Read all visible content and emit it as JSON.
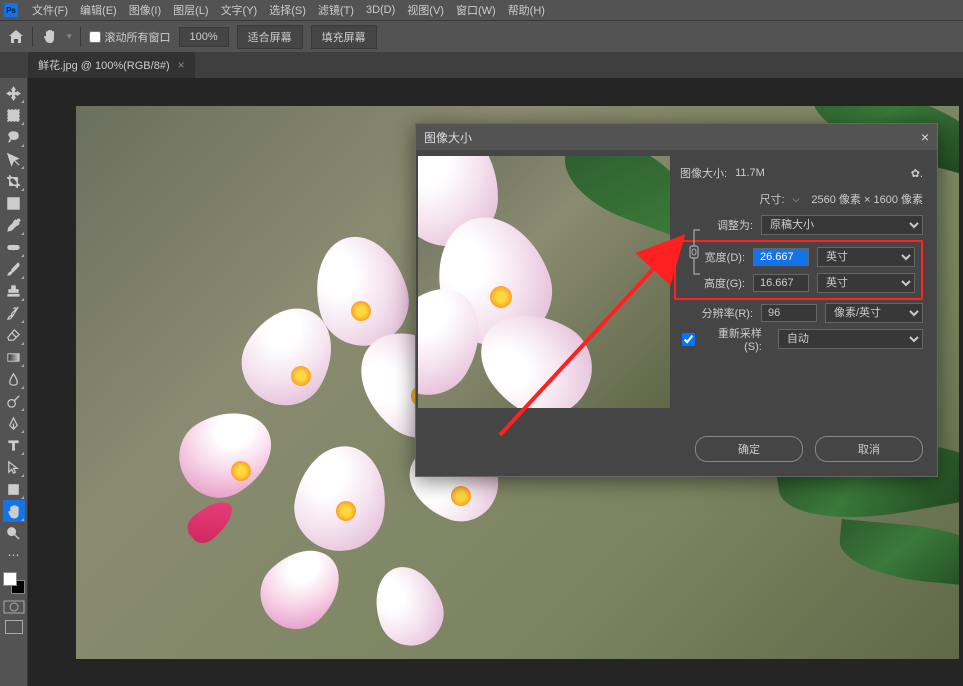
{
  "menubar": {
    "items": [
      "文件(F)",
      "编辑(E)",
      "图像(I)",
      "图层(L)",
      "文字(Y)",
      "选择(S)",
      "滤镜(T)",
      "3D(D)",
      "视图(V)",
      "窗口(W)",
      "帮助(H)"
    ]
  },
  "optbar": {
    "scroll_all": "滚动所有窗口",
    "zoom": "100%",
    "fit": "适合屏幕",
    "fill": "填充屏幕"
  },
  "tab": {
    "title": "鲜花.jpg @ 100%(RGB/8#)"
  },
  "dialog": {
    "title": "图像大小",
    "image_size_lbl": "图像大小:",
    "image_size_val": "11.7M",
    "dim_lbl": "尺寸:",
    "dim_val": "2560 像素 × 1600 像素",
    "adjust_lbl": "调整为:",
    "adjust_val": "原稿大小",
    "width_lbl": "宽度(D):",
    "width_val": "26.667",
    "width_unit": "英寸",
    "height_lbl": "高度(G):",
    "height_val": "16.667",
    "height_unit": "英寸",
    "res_lbl": "分辨率(R):",
    "res_val": "96",
    "res_unit": "像素/英寸",
    "resample_lbl": "重新采样(S):",
    "resample_val": "自动",
    "ok": "确定",
    "cancel": "取消"
  }
}
